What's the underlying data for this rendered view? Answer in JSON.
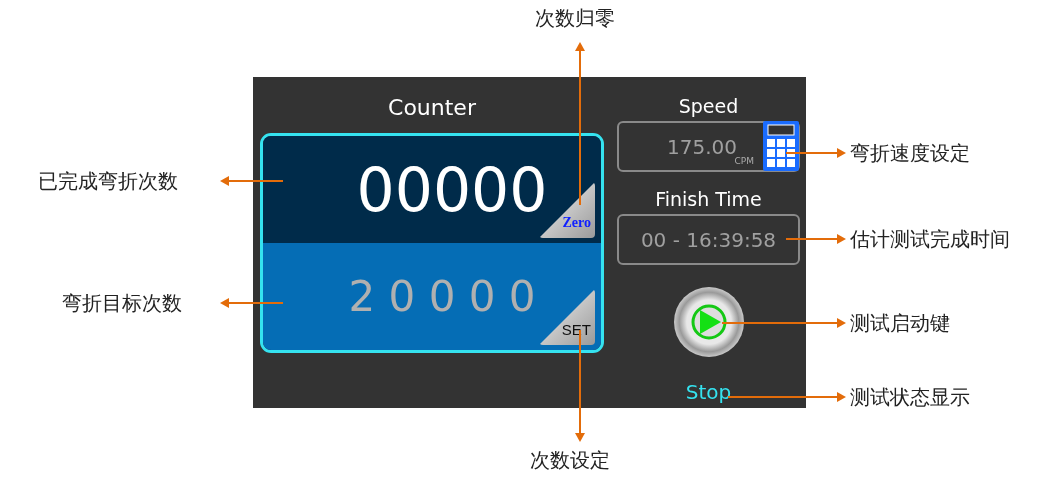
{
  "counter": {
    "title": "Counter",
    "completed": "00000",
    "target": "2 0 0 0 0",
    "zero_button": "Zero",
    "set_button": "SET"
  },
  "speed": {
    "label": "Speed",
    "value": "175.00",
    "unit": "CPM"
  },
  "finish_time": {
    "label": "Finish Time",
    "value": "00 - 16:39:58"
  },
  "status": "Stop",
  "annotations": [
    {
      "text": "次数归零",
      "kind": "top"
    },
    {
      "text": "已完成弯折次数",
      "kind": "left"
    },
    {
      "text": "弯折目标次数",
      "kind": "left"
    },
    {
      "text": "弯折速度设定",
      "kind": "right"
    },
    {
      "text": "估计测试完成时间",
      "kind": "right"
    },
    {
      "text": "测试启动键",
      "kind": "right"
    },
    {
      "text": "测试状态显示",
      "kind": "right"
    },
    {
      "text": "次数设定",
      "kind": "bottom"
    }
  ]
}
